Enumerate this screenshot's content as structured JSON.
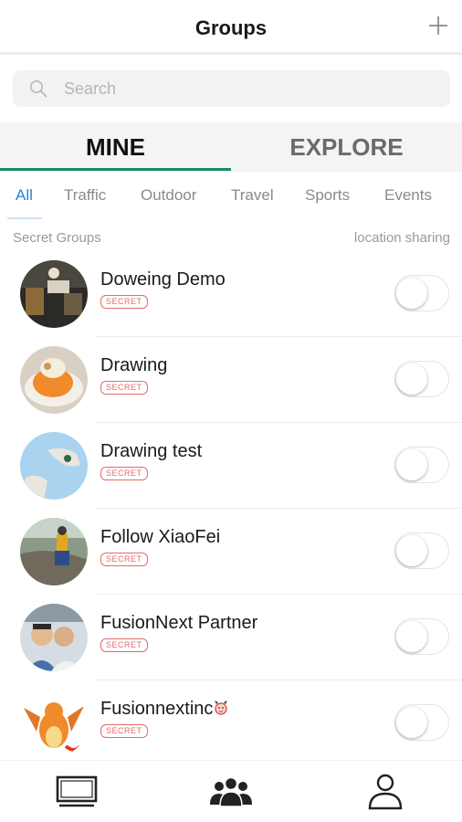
{
  "header": {
    "title": "Groups",
    "add_icon": "plus-icon"
  },
  "search": {
    "placeholder": "Search",
    "icon": "search-icon"
  },
  "segment_tabs": [
    {
      "label": "MINE",
      "active": true
    },
    {
      "label": "EXPLORE",
      "active": false
    }
  ],
  "filters": [
    {
      "label": "All",
      "active": true
    },
    {
      "label": "Traffic",
      "active": false
    },
    {
      "label": "Outdoor",
      "active": false
    },
    {
      "label": "Travel",
      "active": false
    },
    {
      "label": "Sports",
      "active": false
    },
    {
      "label": "Events",
      "active": false
    }
  ],
  "section": {
    "left_label": "Secret Groups",
    "right_label": "location sharing"
  },
  "groups": [
    {
      "name": "Doweing Demo",
      "badge": "SECRET",
      "sharing": false
    },
    {
      "name": "Drawing",
      "badge": "SECRET",
      "sharing": false
    },
    {
      "name": "Drawing test",
      "badge": "SECRET",
      "sharing": false
    },
    {
      "name": "Follow XiaoFei",
      "badge": "SECRET",
      "sharing": false
    },
    {
      "name": "FusionNext Partner",
      "badge": "SECRET",
      "sharing": false
    },
    {
      "name": "Fusionnextinc",
      "badge": "SECRET",
      "sharing": false
    }
  ],
  "tabbar": [
    {
      "icon": "monitor-icon",
      "active": false
    },
    {
      "icon": "groups-icon",
      "active": true
    },
    {
      "icon": "profile-icon",
      "active": false
    }
  ],
  "colors": {
    "accent_green": "#1a8a63",
    "filter_active": "#2a7fd4",
    "badge_red": "#e76a6a"
  }
}
